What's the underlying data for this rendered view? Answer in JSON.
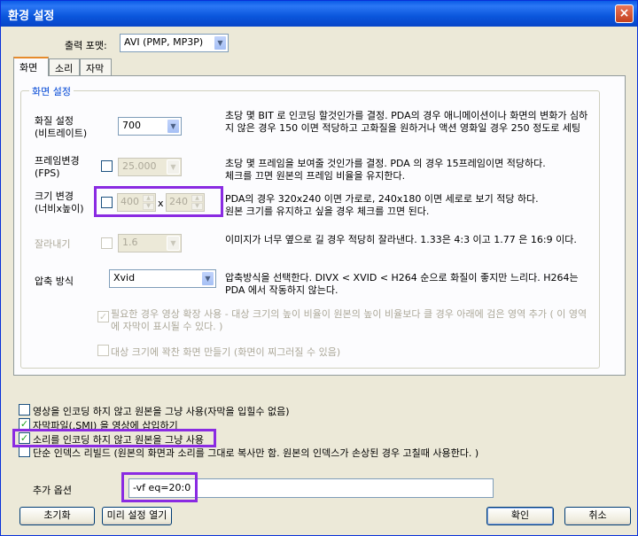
{
  "window": {
    "title": "환경 설정",
    "close": "×"
  },
  "output_format": {
    "label": "출력 포맷:",
    "value": "AVI (PMP, MP3P)"
  },
  "tabs": [
    {
      "label": "화면"
    },
    {
      "label": "소리"
    },
    {
      "label": "자막"
    }
  ],
  "group": {
    "title": "화면 설정"
  },
  "quality": {
    "label": "화질 설정\n(비트레이트)",
    "value": "700",
    "desc": "초당 몇 BIT 로 인코딩 할것인가를 결정. PDA의 경우 애니메이션이나 화면의 변화가 심하지 않은 경우 150 이면 적당하고 고화질을 원하거나 액션 영화일 경우 250 정도로 세팅"
  },
  "fps": {
    "label": "프레임변경\n(FPS)",
    "checked": false,
    "value": "25.000",
    "desc": "초당 몇 프레임을 보여줄 것인가를 결정. PDA 의 경우 15프레임이면 적당하다.\n체크를 끄면 원본의 프레임 비율을 유지한다."
  },
  "size": {
    "label": "크기 변경\n(너비x높이)",
    "checked": false,
    "width": "400",
    "x": "x",
    "height": "240",
    "desc": "PDA의 경우 320x240 이면 가로로, 240x180 이면 세로로 보기 적당 하다.\n원본 크기를 유지하고 싶을 경우 체크를 끄면 된다."
  },
  "crop": {
    "label": "잘라내기",
    "checked": false,
    "value": "1.6",
    "desc": "이미지가 너무 옆으로 길 경우 적당히 잘라낸다. 1.33은 4:3 이고 1.77 은 16:9 이다."
  },
  "codec": {
    "label": "압축 방식",
    "value": "Xvid",
    "desc": "압축방식을 선택한다.  DIVX < XVID < H264 순으로 화질이 좋지만 느리다. H264는 PDA 에서 작동하지 않는다."
  },
  "expand": {
    "checked": true,
    "label": "필요한 경우 영상 확장 사용 - 대상 크기의 높이 비율이 원본의 높이 비율보다 클 경우 아래에 검은  영역 추가 ( 이 영역에 자막이 표시될 수 있다. )"
  },
  "fit": {
    "checked": false,
    "label": "대상 크기에 꽉찬 화면 만들기 (화면이 찌그러질 수 있음)"
  },
  "options": [
    {
      "checked": false,
      "label": "영상을 인코딩 하지 않고 원본을 그냥 사용(자막을 입힐수 없음)"
    },
    {
      "checked": true,
      "label": "자막파일(.SMI) 을 영상에 삽입하기"
    },
    {
      "checked": true,
      "label": "소리를 인코딩 하지 않고 원본을 그냥 사용"
    },
    {
      "checked": false,
      "label": "단순 인덱스 리빌드 (원본의 화면과 소리를 그대로 복사만 함. 원본의 인덱스가 손상된 경우 고칠때 사용한다. )"
    }
  ],
  "extra": {
    "label": "추가 옵션",
    "value": "-vf eq=20:0"
  },
  "buttons": {
    "reset": "초기화",
    "preset": "미리 설정 열기",
    "ok": "확인",
    "cancel": "취소"
  },
  "highlight_color": "#8a2be2"
}
